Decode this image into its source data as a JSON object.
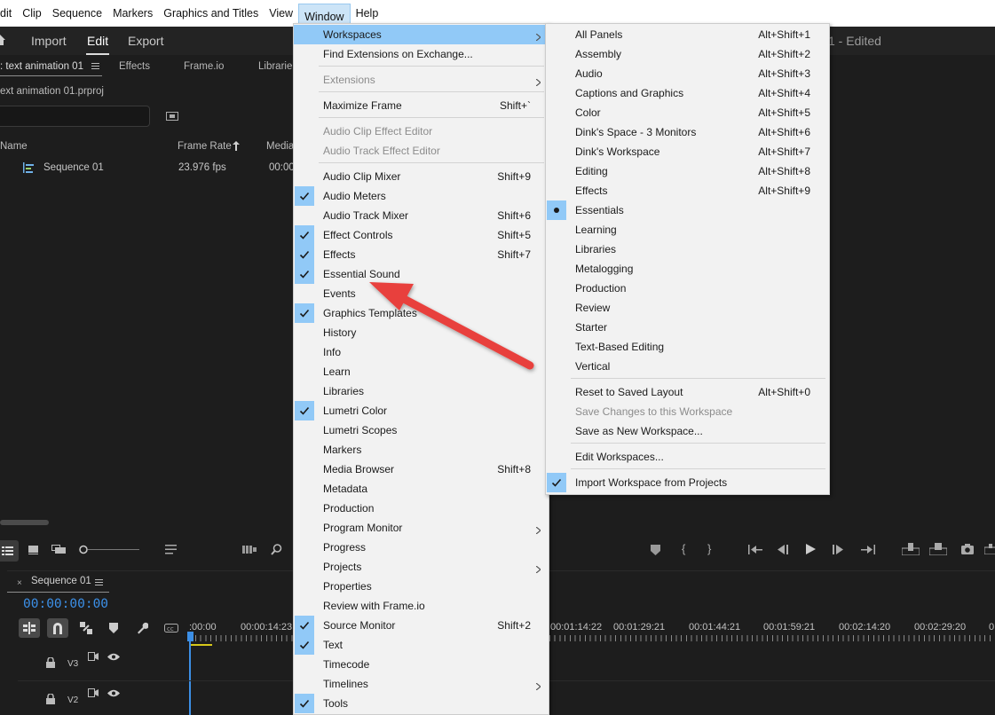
{
  "menubar": {
    "items": [
      {
        "label": "dit"
      },
      {
        "label": "Clip"
      },
      {
        "label": "Sequence"
      },
      {
        "label": "Markers"
      },
      {
        "label": "Graphics and Titles"
      },
      {
        "label": "View"
      },
      {
        "label": "Window"
      },
      {
        "label": "Help"
      }
    ],
    "active": "Window"
  },
  "header": {
    "tabs": [
      {
        "label": "Import"
      },
      {
        "label": "Edit"
      },
      {
        "label": "Export"
      }
    ],
    "selected_tab": "Edit",
    "doc_title": "1 - Edited"
  },
  "project_panel": {
    "tabs": [
      {
        "label": ": text animation 01"
      },
      {
        "label": "Effects"
      },
      {
        "label": "Frame.io"
      },
      {
        "label": "Librarie"
      }
    ],
    "project_file": "ext animation 01.prproj",
    "search_placeholder": "",
    "columns": [
      {
        "label": "Name"
      },
      {
        "label": "Frame Rate"
      },
      {
        "label": "Media"
      }
    ],
    "rows": [
      {
        "name": "Sequence 01",
        "frame_rate": "23.976 fps",
        "media": "00:00"
      }
    ]
  },
  "timeline": {
    "sequence_name": "Sequence 01",
    "timecode": "00:00:00:00",
    "ruler_labels": [
      {
        "label": ":00:00"
      },
      {
        "label": "00:00:14:23"
      },
      {
        "label": "00:01:14:22"
      },
      {
        "label": "00:01:29:21"
      },
      {
        "label": "00:01:44:21"
      },
      {
        "label": "00:01:59:21"
      },
      {
        "label": "00:02:14:20"
      },
      {
        "label": "00:02:29:20"
      },
      {
        "label": "0"
      }
    ],
    "tracks": [
      {
        "name": "V3"
      },
      {
        "name": "V2"
      }
    ]
  },
  "window_menu": {
    "items": [
      {
        "label": "Workspaces",
        "shortcut": "",
        "checked": false,
        "disabled": false,
        "submenu": true,
        "highlighted": true
      },
      {
        "label": "Find Extensions on Exchange...",
        "shortcut": "",
        "checked": false,
        "disabled": false,
        "submenu": false
      },
      {
        "label": "Extensions",
        "shortcut": "",
        "checked": false,
        "disabled": true,
        "submenu": true
      },
      {
        "label": "Maximize Frame",
        "shortcut": "Shift+`",
        "checked": false,
        "disabled": false,
        "submenu": false
      },
      {
        "label": "Audio Clip Effect Editor",
        "shortcut": "",
        "checked": false,
        "disabled": true,
        "submenu": false
      },
      {
        "label": "Audio Track Effect Editor",
        "shortcut": "",
        "checked": false,
        "disabled": true,
        "submenu": false
      },
      {
        "label": "Audio Clip Mixer",
        "shortcut": "Shift+9",
        "checked": false,
        "disabled": false,
        "submenu": false
      },
      {
        "label": "Audio Meters",
        "shortcut": "",
        "checked": true,
        "disabled": false,
        "submenu": false
      },
      {
        "label": "Audio Track Mixer",
        "shortcut": "Shift+6",
        "checked": false,
        "disabled": false,
        "submenu": false
      },
      {
        "label": "Effect Controls",
        "shortcut": "Shift+5",
        "checked": true,
        "disabled": false,
        "submenu": false
      },
      {
        "label": "Effects",
        "shortcut": "Shift+7",
        "checked": true,
        "disabled": false,
        "submenu": false
      },
      {
        "label": "Essential Sound",
        "shortcut": "",
        "checked": true,
        "disabled": false,
        "submenu": false
      },
      {
        "label": "Events",
        "shortcut": "",
        "checked": false,
        "disabled": false,
        "submenu": false
      },
      {
        "label": "Graphics Templates",
        "shortcut": "",
        "checked": true,
        "disabled": false,
        "submenu": false
      },
      {
        "label": "History",
        "shortcut": "",
        "checked": false,
        "disabled": false,
        "submenu": false
      },
      {
        "label": "Info",
        "shortcut": "",
        "checked": false,
        "disabled": false,
        "submenu": false
      },
      {
        "label": "Learn",
        "shortcut": "",
        "checked": false,
        "disabled": false,
        "submenu": false
      },
      {
        "label": "Libraries",
        "shortcut": "",
        "checked": false,
        "disabled": false,
        "submenu": false
      },
      {
        "label": "Lumetri Color",
        "shortcut": "",
        "checked": true,
        "disabled": false,
        "submenu": false
      },
      {
        "label": "Lumetri Scopes",
        "shortcut": "",
        "checked": false,
        "disabled": false,
        "submenu": false
      },
      {
        "label": "Markers",
        "shortcut": "",
        "checked": false,
        "disabled": false,
        "submenu": false
      },
      {
        "label": "Media Browser",
        "shortcut": "Shift+8",
        "checked": false,
        "disabled": false,
        "submenu": false
      },
      {
        "label": "Metadata",
        "shortcut": "",
        "checked": false,
        "disabled": false,
        "submenu": false
      },
      {
        "label": "Production",
        "shortcut": "",
        "checked": false,
        "disabled": false,
        "submenu": false
      },
      {
        "label": "Program Monitor",
        "shortcut": "",
        "checked": false,
        "disabled": false,
        "submenu": true
      },
      {
        "label": "Progress",
        "shortcut": "",
        "checked": false,
        "disabled": false,
        "submenu": false
      },
      {
        "label": "Projects",
        "shortcut": "",
        "checked": false,
        "disabled": false,
        "submenu": true
      },
      {
        "label": "Properties",
        "shortcut": "",
        "checked": false,
        "disabled": false,
        "submenu": false
      },
      {
        "label": "Review with Frame.io",
        "shortcut": "",
        "checked": false,
        "disabled": false,
        "submenu": false
      },
      {
        "label": "Source Monitor",
        "shortcut": "Shift+2",
        "checked": true,
        "disabled": false,
        "submenu": false
      },
      {
        "label": "Text",
        "shortcut": "",
        "checked": true,
        "disabled": false,
        "submenu": false
      },
      {
        "label": "Timecode",
        "shortcut": "",
        "checked": false,
        "disabled": false,
        "submenu": false
      },
      {
        "label": "Timelines",
        "shortcut": "",
        "checked": false,
        "disabled": false,
        "submenu": true
      },
      {
        "label": "Tools",
        "shortcut": "",
        "checked": true,
        "disabled": false,
        "submenu": false
      }
    ]
  },
  "workspaces_menu": {
    "items": [
      {
        "label": "All Panels",
        "shortcut": "Alt+Shift+1"
      },
      {
        "label": "Assembly",
        "shortcut": "Alt+Shift+2"
      },
      {
        "label": "Audio",
        "shortcut": "Alt+Shift+3"
      },
      {
        "label": "Captions and Graphics",
        "shortcut": "Alt+Shift+4"
      },
      {
        "label": "Color",
        "shortcut": "Alt+Shift+5"
      },
      {
        "label": "Dink's Space - 3 Monitors",
        "shortcut": "Alt+Shift+6"
      },
      {
        "label": "Dink's Workspace",
        "shortcut": "Alt+Shift+7"
      },
      {
        "label": "Editing",
        "shortcut": "Alt+Shift+8"
      },
      {
        "label": "Effects",
        "shortcut": "Alt+Shift+9"
      },
      {
        "label": "Essentials",
        "shortcut": "",
        "selected": true
      },
      {
        "label": "Learning",
        "shortcut": ""
      },
      {
        "label": "Libraries",
        "shortcut": ""
      },
      {
        "label": "Metalogging",
        "shortcut": ""
      },
      {
        "label": "Production",
        "shortcut": ""
      },
      {
        "label": "Review",
        "shortcut": ""
      },
      {
        "label": "Starter",
        "shortcut": ""
      },
      {
        "label": "Text-Based Editing",
        "shortcut": ""
      },
      {
        "label": "Vertical",
        "shortcut": ""
      },
      {
        "label": "Reset to Saved Layout",
        "shortcut": "Alt+Shift+0"
      },
      {
        "label": "Save Changes to this Workspace",
        "shortcut": "",
        "disabled": true
      },
      {
        "label": "Save as New Workspace...",
        "shortcut": ""
      },
      {
        "label": "Edit Workspaces...",
        "shortcut": ""
      },
      {
        "label": "Import Workspace from Projects",
        "shortcut": "",
        "checked": true
      }
    ]
  },
  "colors": {
    "menu_highlight": "#91c9f7",
    "timecode_blue": "#3c8fe6",
    "annotation_arrow": "#e8413c"
  }
}
